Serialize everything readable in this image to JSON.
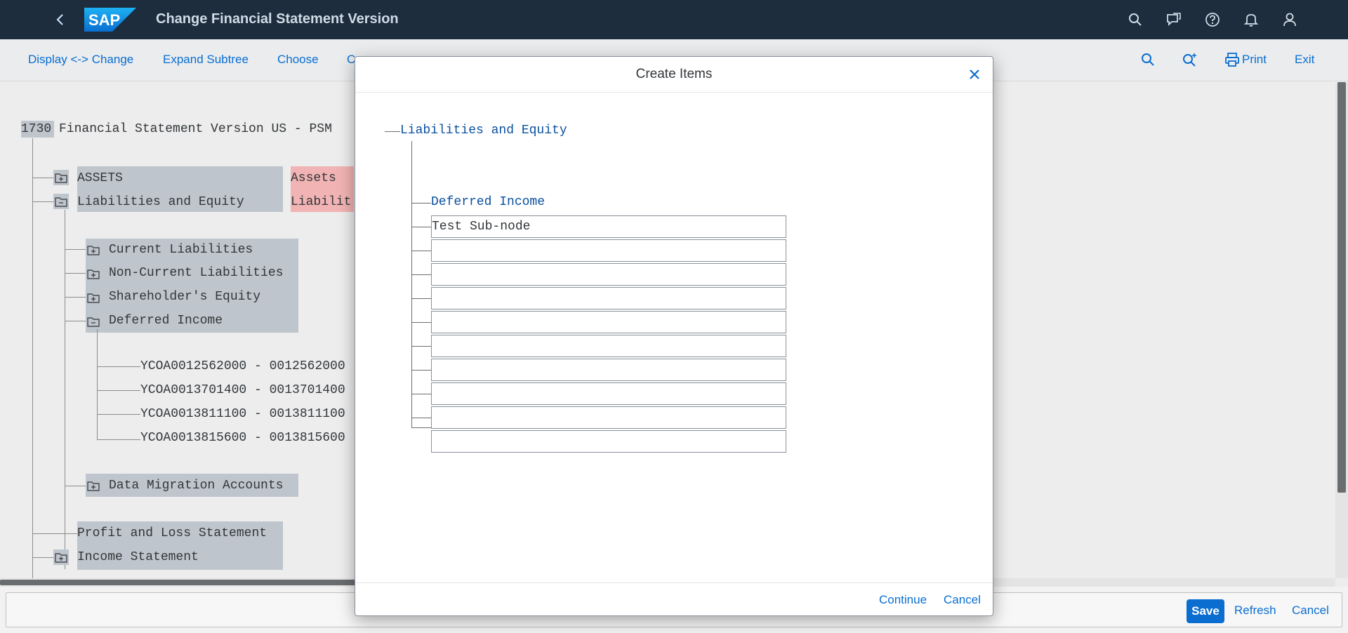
{
  "shell": {
    "title": "Change Financial Statement Version",
    "logo_text": "SAP"
  },
  "toolbar": {
    "items": [
      "Display <-> Change",
      "Expand Subtree",
      "Choose",
      "C",
      "Print",
      "Exit"
    ]
  },
  "tree": {
    "root": "1730 Financial Statement Version US - PSM",
    "assets": "ASSETS",
    "assets_desc": "Assets",
    "liab_equity": "Liabilities and Equity",
    "liab_equity_desc": "Liabilit",
    "current_liab": "Current Liabilities",
    "noncurrent_liab": "Non-Current Liabilities",
    "shareholders_equity": "Shareholder's Equity",
    "deferred_income": "Deferred Income",
    "accounts": [
      "YCOA0012562000 - 0012562000",
      "YCOA0013701400 - 0013701400",
      "YCOA0013811100 - 0013811100",
      "YCOA0013815600 - 0013815600"
    ],
    "data_migration": "Data Migration Accounts",
    "pl_statement": "Profit and Loss Statement",
    "income_statement": "Income Statement"
  },
  "dialog": {
    "title": "Create Items",
    "parent_node": "Liabilities and Equity",
    "child_node": "Deferred Income",
    "inputs": [
      "Test Sub-node",
      "",
      "",
      "",
      "",
      "",
      "",
      "",
      "",
      ""
    ],
    "continue_label": "Continue",
    "cancel_label": "Cancel"
  },
  "footer": {
    "save_label": "Save",
    "refresh_label": "Refresh",
    "cancel_label": "Cancel"
  },
  "colors": {
    "shell_bg": "#1d2d3e",
    "accent": "#0a6ed1",
    "highlight": "#bfc5cc",
    "highlight_red": "#f1b3b3"
  }
}
